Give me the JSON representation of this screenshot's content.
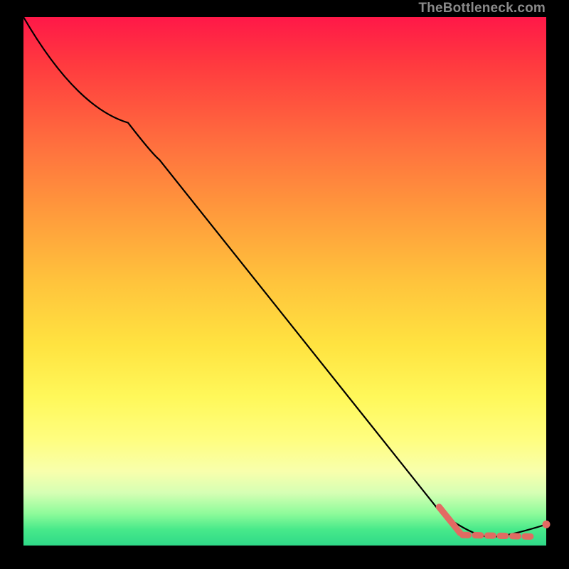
{
  "attribution": "TheBottleneck.com",
  "colors": {
    "line": "#000000",
    "marker": "#e36a63",
    "marker_dash": "#e06b62"
  },
  "chart_data": {
    "type": "line",
    "title": "",
    "xlabel": "",
    "ylabel": "",
    "xlim": [
      0,
      100
    ],
    "ylim": [
      0,
      100
    ],
    "series": [
      {
        "name": "curve",
        "style": "solid-thin",
        "points": [
          {
            "x": 0,
            "y": 100
          },
          {
            "x": 20,
            "y": 80
          },
          {
            "x": 26,
            "y": 73
          },
          {
            "x": 80,
            "y": 6
          },
          {
            "x": 86,
            "y": 1.8
          },
          {
            "x": 92,
            "y": 1.5
          },
          {
            "x": 100,
            "y": 4
          }
        ]
      },
      {
        "name": "highlight-slope",
        "style": "thick-pink",
        "points": [
          {
            "x": 79.5,
            "y": 7.3
          },
          {
            "x": 83.5,
            "y": 2.4
          }
        ]
      },
      {
        "name": "highlight-flat",
        "style": "dashed-pink",
        "points": [
          {
            "x": 84,
            "y": 2.0
          },
          {
            "x": 97,
            "y": 1.7
          }
        ]
      },
      {
        "name": "end-marker",
        "style": "dot-pink",
        "points": [
          {
            "x": 100,
            "y": 4
          }
        ]
      }
    ]
  }
}
